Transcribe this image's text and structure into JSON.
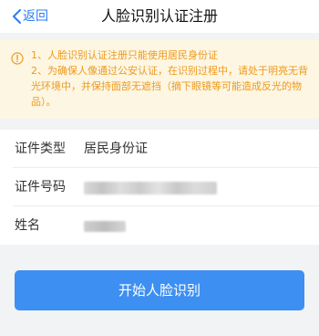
{
  "nav": {
    "back_label": "返回",
    "back_icon": "chevron-left-icon",
    "title": "人脸识别认证注册"
  },
  "notice": {
    "icon": "warning-circle-icon",
    "line1": "1、人脸识别认证注册只能使用居民身份证",
    "line2": "2、为确保人像通过公安认证，在识别过程中，请处于明亮无背光环境中，并保持面部无遮挡（摘下眼镜等可能造成反光的物品）。"
  },
  "form": {
    "rows": [
      {
        "label": "证件类型",
        "value": "居民身份证"
      },
      {
        "label": "证件号码",
        "value": ""
      },
      {
        "label": "姓名",
        "value": ""
      }
    ]
  },
  "button": {
    "label": "开始人脸识别"
  },
  "colors": {
    "accent": "#2b7cf6",
    "button": "#3d8ff2",
    "notice_text": "#ee9a1d",
    "notice_bg": "#fdf6e3",
    "page_bg": "#f2f3f5"
  }
}
